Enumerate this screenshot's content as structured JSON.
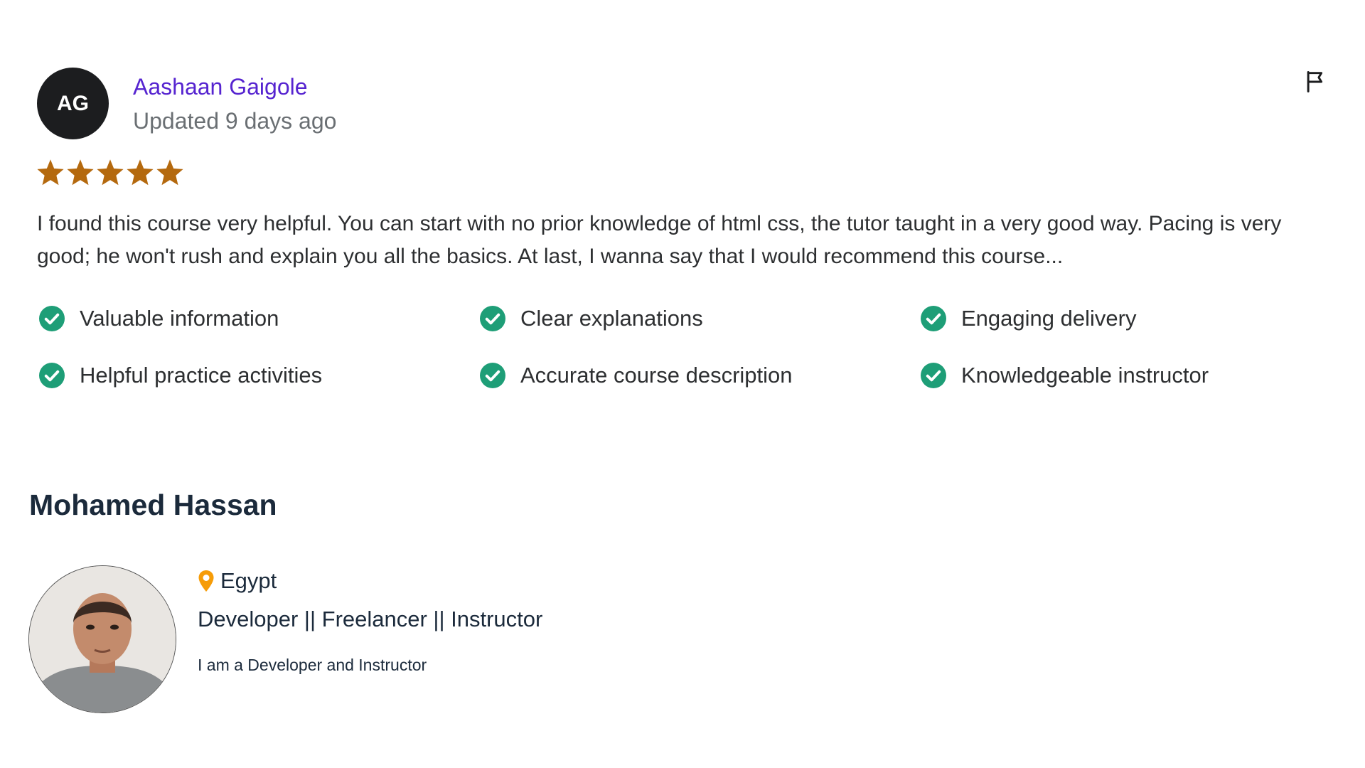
{
  "review": {
    "initials": "AG",
    "reviewer_name": "Aashaan Gaigole",
    "date": "Updated 9 days ago",
    "rating": 5,
    "rating_max": 5,
    "text": "I found this course very helpful. You can start with no prior knowledge of html css, the tutor taught in a very good way. Pacing is very good; he won't rush and explain you all the basics. At last, I wanna say that I would recommend this course...",
    "tags": [
      "Valuable information",
      "Clear explanations",
      "Engaging delivery",
      "Helpful practice activities",
      "Accurate course description",
      "Knowledgeable instructor"
    ],
    "icons": {
      "flag": "flag-icon",
      "star": "star-icon",
      "check": "check-circle-icon"
    }
  },
  "instructor": {
    "name": "Mohamed Hassan",
    "location": "Egypt",
    "headline": "Developer || Freelancer || Instructor",
    "bio": "I am a Developer and Instructor",
    "icons": {
      "location": "map-pin-icon",
      "photo": "avatar"
    }
  },
  "colors": {
    "reviewer_name": "#5624d0",
    "star": "#b4690e",
    "check": "#1e9e77",
    "pin": "#f69c08",
    "heading": "#1b2a3b"
  }
}
